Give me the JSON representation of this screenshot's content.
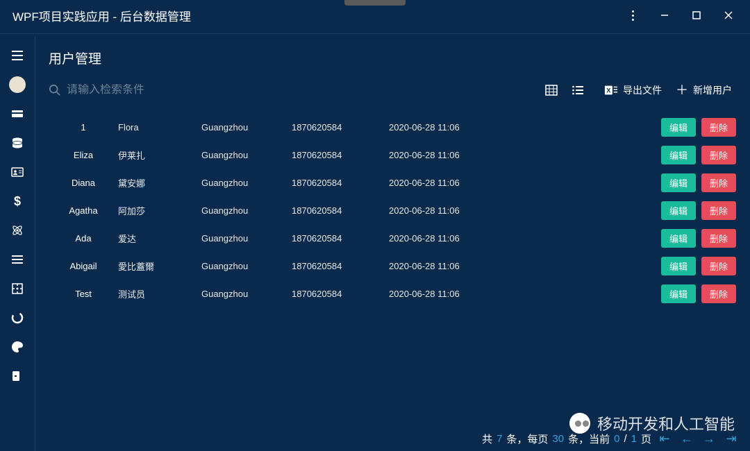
{
  "window": {
    "title": "WPF项目实践应用 - 后台数据管理"
  },
  "page": {
    "title": "用户管理"
  },
  "search": {
    "placeholder": "请输入检索条件"
  },
  "toolbar": {
    "export_label": "导出文件",
    "add_label": "新增用户"
  },
  "table": {
    "rows": [
      {
        "c1": "1",
        "c2": "Flora",
        "c3": "Guangzhou",
        "c4": "1870620584",
        "c5": "2020-06-28 11:06"
      },
      {
        "c1": "Eliza",
        "c2": "伊莱扎",
        "c3": "Guangzhou",
        "c4": "1870620584",
        "c5": "2020-06-28 11:06"
      },
      {
        "c1": "Diana",
        "c2": "黛安娜",
        "c3": "Guangzhou",
        "c4": "1870620584",
        "c5": "2020-06-28 11:06"
      },
      {
        "c1": "Agatha",
        "c2": "阿加莎",
        "c3": "Guangzhou",
        "c4": "1870620584",
        "c5": "2020-06-28 11:06"
      },
      {
        "c1": "Ada",
        "c2": "爱达",
        "c3": "Guangzhou",
        "c4": "1870620584",
        "c5": "2020-06-28 11:06"
      },
      {
        "c1": "Abigail",
        "c2": "愛比蓋爾",
        "c3": "Guangzhou",
        "c4": "1870620584",
        "c5": "2020-06-28 11:06"
      },
      {
        "c1": "Test",
        "c2": "测试员",
        "c3": "Guangzhou",
        "c4": "1870620584",
        "c5": "2020-06-28 11:06"
      }
    ],
    "edit_label": "编辑",
    "delete_label": "删除"
  },
  "pager": {
    "prefix": "共 ",
    "total": "7",
    "unit1": " 条，每页 ",
    "per": "30",
    "unit2": " 条，当前 ",
    "cur": "0",
    "slash": " / ",
    "pages": "1",
    "suffix": " 页"
  },
  "watermark": {
    "text": "移动开发和人工智能"
  }
}
